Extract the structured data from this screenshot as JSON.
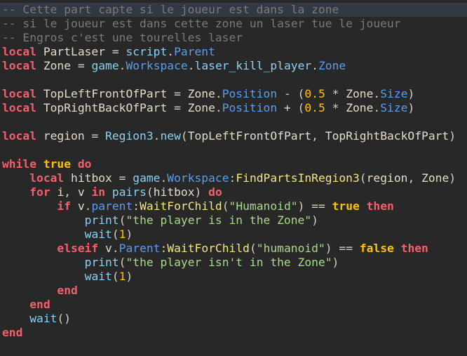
{
  "editor": {
    "highlighted_line": 0,
    "lines": [
      [
        [
          "cm",
          "-- Cette part capte si le joueur est dans la zone"
        ]
      ],
      [
        [
          "cm",
          "-- si le joueur est dans cette zone un laser tue le joueur"
        ]
      ],
      [
        [
          "cm",
          "-- Engros c'est une tourelles laser"
        ]
      ],
      [
        [
          "kw",
          "local"
        ],
        [
          "id",
          " PartLaser "
        ],
        [
          "op",
          "= "
        ],
        [
          "bi",
          "script"
        ],
        [
          "op",
          "."
        ],
        [
          "mem",
          "Parent"
        ]
      ],
      [
        [
          "kw",
          "local"
        ],
        [
          "id",
          " Zone "
        ],
        [
          "op",
          "= "
        ],
        [
          "bi",
          "game"
        ],
        [
          "op",
          "."
        ],
        [
          "mem",
          "Workspace"
        ],
        [
          "op",
          "."
        ],
        [
          "bi",
          "laser_kill_player"
        ],
        [
          "op",
          "."
        ],
        [
          "mem",
          "Zone"
        ]
      ],
      [],
      [
        [
          "kw",
          "local"
        ],
        [
          "id",
          " TopLeftFrontOfPart "
        ],
        [
          "op",
          "= "
        ],
        [
          "id",
          "Zone"
        ],
        [
          "op",
          "."
        ],
        [
          "mem",
          "Position"
        ],
        [
          "op",
          " - ("
        ],
        [
          "num",
          "0.5"
        ],
        [
          "op",
          " * "
        ],
        [
          "id",
          "Zone"
        ],
        [
          "op",
          "."
        ],
        [
          "mem",
          "Size"
        ],
        [
          "op",
          ")"
        ]
      ],
      [
        [
          "kw",
          "local"
        ],
        [
          "id",
          " TopRightBackOfPart "
        ],
        [
          "op",
          "= "
        ],
        [
          "id",
          "Zone"
        ],
        [
          "op",
          "."
        ],
        [
          "mem",
          "Position"
        ],
        [
          "op",
          " + ("
        ],
        [
          "num",
          "0.5"
        ],
        [
          "op",
          " * "
        ],
        [
          "id",
          "Zone"
        ],
        [
          "op",
          "."
        ],
        [
          "mem",
          "Size"
        ],
        [
          "op",
          ")"
        ]
      ],
      [],
      [
        [
          "kw",
          "local"
        ],
        [
          "id",
          " region "
        ],
        [
          "op",
          "= "
        ],
        [
          "bi",
          "Region3"
        ],
        [
          "op",
          "."
        ],
        [
          "bi",
          "new"
        ],
        [
          "op",
          "("
        ],
        [
          "id",
          "TopLeftFrontOfPart"
        ],
        [
          "op",
          ", "
        ],
        [
          "id",
          "TopRightBackOfPart"
        ],
        [
          "op",
          ")"
        ]
      ],
      [],
      [
        [
          "kw",
          "while"
        ],
        [
          "op",
          " "
        ],
        [
          "lit",
          "true"
        ],
        [
          "op",
          " "
        ],
        [
          "kw",
          "do"
        ]
      ],
      [
        [
          "op",
          "    "
        ],
        [
          "kw",
          "local"
        ],
        [
          "id",
          " hitbox "
        ],
        [
          "op",
          "= "
        ],
        [
          "bi",
          "game"
        ],
        [
          "op",
          "."
        ],
        [
          "mem",
          "Workspace"
        ],
        [
          "op",
          ":"
        ],
        [
          "fn",
          "FindPartsInRegion3"
        ],
        [
          "op",
          "("
        ],
        [
          "id",
          "region"
        ],
        [
          "op",
          ", "
        ],
        [
          "id",
          "Zone"
        ],
        [
          "op",
          ")"
        ]
      ],
      [
        [
          "op",
          "    "
        ],
        [
          "kw",
          "for"
        ],
        [
          "id",
          " i"
        ],
        [
          "op",
          ", "
        ],
        [
          "id",
          "v "
        ],
        [
          "kw",
          "in"
        ],
        [
          "op",
          " "
        ],
        [
          "bi",
          "pairs"
        ],
        [
          "op",
          "("
        ],
        [
          "id",
          "hitbox"
        ],
        [
          "op",
          ") "
        ],
        [
          "kw",
          "do"
        ]
      ],
      [
        [
          "op",
          "        "
        ],
        [
          "kw",
          "if"
        ],
        [
          "id",
          " v"
        ],
        [
          "op",
          "."
        ],
        [
          "mem",
          "parent"
        ],
        [
          "op",
          ":"
        ],
        [
          "fn",
          "WaitForChild"
        ],
        [
          "op",
          "("
        ],
        [
          "str",
          "\"Humanoid\""
        ],
        [
          "op",
          ") == "
        ],
        [
          "lit",
          "true"
        ],
        [
          "op",
          " "
        ],
        [
          "kw",
          "then"
        ]
      ],
      [
        [
          "op",
          "            "
        ],
        [
          "bi",
          "print"
        ],
        [
          "op",
          "("
        ],
        [
          "str",
          "\"the player is in the Zone\""
        ],
        [
          "op",
          ")"
        ]
      ],
      [
        [
          "op",
          "            "
        ],
        [
          "bi",
          "wait"
        ],
        [
          "op",
          "("
        ],
        [
          "num",
          "1"
        ],
        [
          "op",
          ")"
        ]
      ],
      [
        [
          "op",
          "        "
        ],
        [
          "kw",
          "elseif"
        ],
        [
          "id",
          " v"
        ],
        [
          "op",
          "."
        ],
        [
          "mem",
          "Parent"
        ],
        [
          "op",
          ":"
        ],
        [
          "fn",
          "WaitForChild"
        ],
        [
          "op",
          "("
        ],
        [
          "str",
          "\"humanoid\""
        ],
        [
          "op",
          ") == "
        ],
        [
          "lit",
          "false"
        ],
        [
          "op",
          " "
        ],
        [
          "kw",
          "then"
        ]
      ],
      [
        [
          "op",
          "            "
        ],
        [
          "bi",
          "print"
        ],
        [
          "op",
          "("
        ],
        [
          "str",
          "\"the player isn't in the Zone\""
        ],
        [
          "op",
          ")"
        ]
      ],
      [
        [
          "op",
          "            "
        ],
        [
          "bi",
          "wait"
        ],
        [
          "op",
          "("
        ],
        [
          "num",
          "1"
        ],
        [
          "op",
          ")"
        ]
      ],
      [
        [
          "op",
          "        "
        ],
        [
          "kw",
          "end"
        ]
      ],
      [
        [
          "op",
          "    "
        ],
        [
          "kw",
          "end"
        ]
      ],
      [
        [
          "op",
          "    "
        ],
        [
          "bi",
          "wait"
        ],
        [
          "op",
          "()"
        ]
      ],
      [
        [
          "kw",
          "end"
        ]
      ]
    ]
  }
}
